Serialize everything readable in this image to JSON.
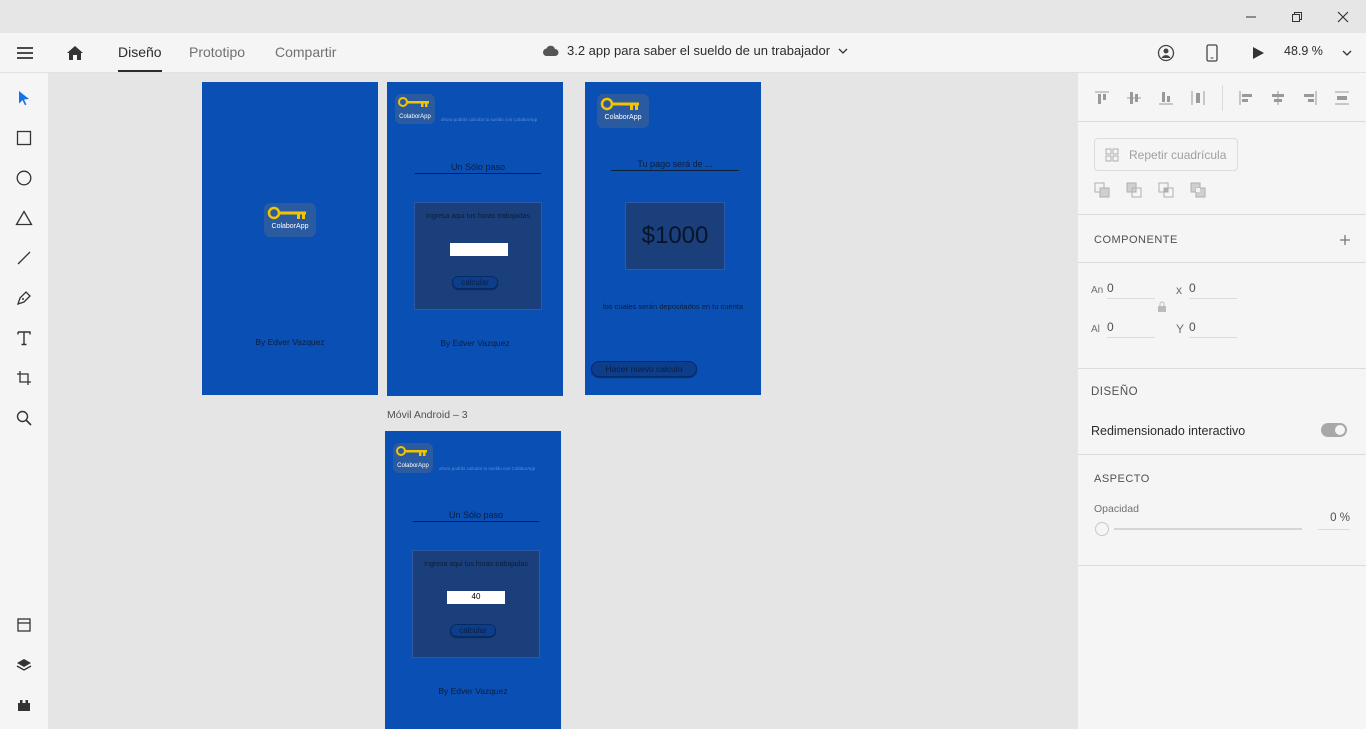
{
  "window": {
    "minimize_icon": "minimize-icon",
    "maximize_icon": "restore-icon",
    "close_icon": "close-icon"
  },
  "appbar": {
    "tabs": [
      {
        "label": "Diseño"
      },
      {
        "label": "Prototipo"
      },
      {
        "label": "Compartir"
      }
    ],
    "document_title": "3.2 app para saber el sueldo de un trabajador",
    "zoom": "48.9 %"
  },
  "artboards": {
    "splash": {
      "logo_text": "ColaborApp",
      "author": "By Edver Vazquez"
    },
    "input_empty": {
      "logo_text": "ColaborApp",
      "tagline": "ahora podrás calcular tu sueldo con ColaborApp",
      "heading": "Un Sólo paso",
      "prompt": "Ingresa aqui tus horas trabajadas",
      "input_value": "",
      "button": "calcular",
      "author": "By Edver Vazquez"
    },
    "result": {
      "logo_text": "ColaborApp",
      "heading": "Tu pago será de ...",
      "amount": "$1000",
      "note": "los cuales serán depositados en tu cuenta",
      "button": "Hacer nuevo calculo"
    },
    "android3": {
      "label": "Móvil Android – 3",
      "logo_text": "ColaborApp",
      "tagline": "ahora podrás calcular tu sueldo con ColaborApp",
      "heading": "Un Sólo paso",
      "prompt": "Ingresa aqui tus horas trabajadas",
      "input_value": "40",
      "button": "calcular",
      "author": "By Edver Vazquez"
    }
  },
  "panel": {
    "repeat_grid": "Repetir cuadrícula",
    "component_title": "COMPONENTE",
    "width_label": "An",
    "width": "0",
    "x_label": "x",
    "x": "0",
    "height_label": "Al",
    "height": "0",
    "y_label": "Y",
    "y": "0",
    "design_title": "DISEÑO",
    "responsive_label": "Redimensionado interactivo",
    "aspect_title": "ASPECTO",
    "opacity_label": "Opacidad",
    "opacity_value": "0 %"
  },
  "colors": {
    "artboard": "#0a4fb4",
    "accent_blue": "#1473e6",
    "logo_yellow": "#f2c500"
  }
}
